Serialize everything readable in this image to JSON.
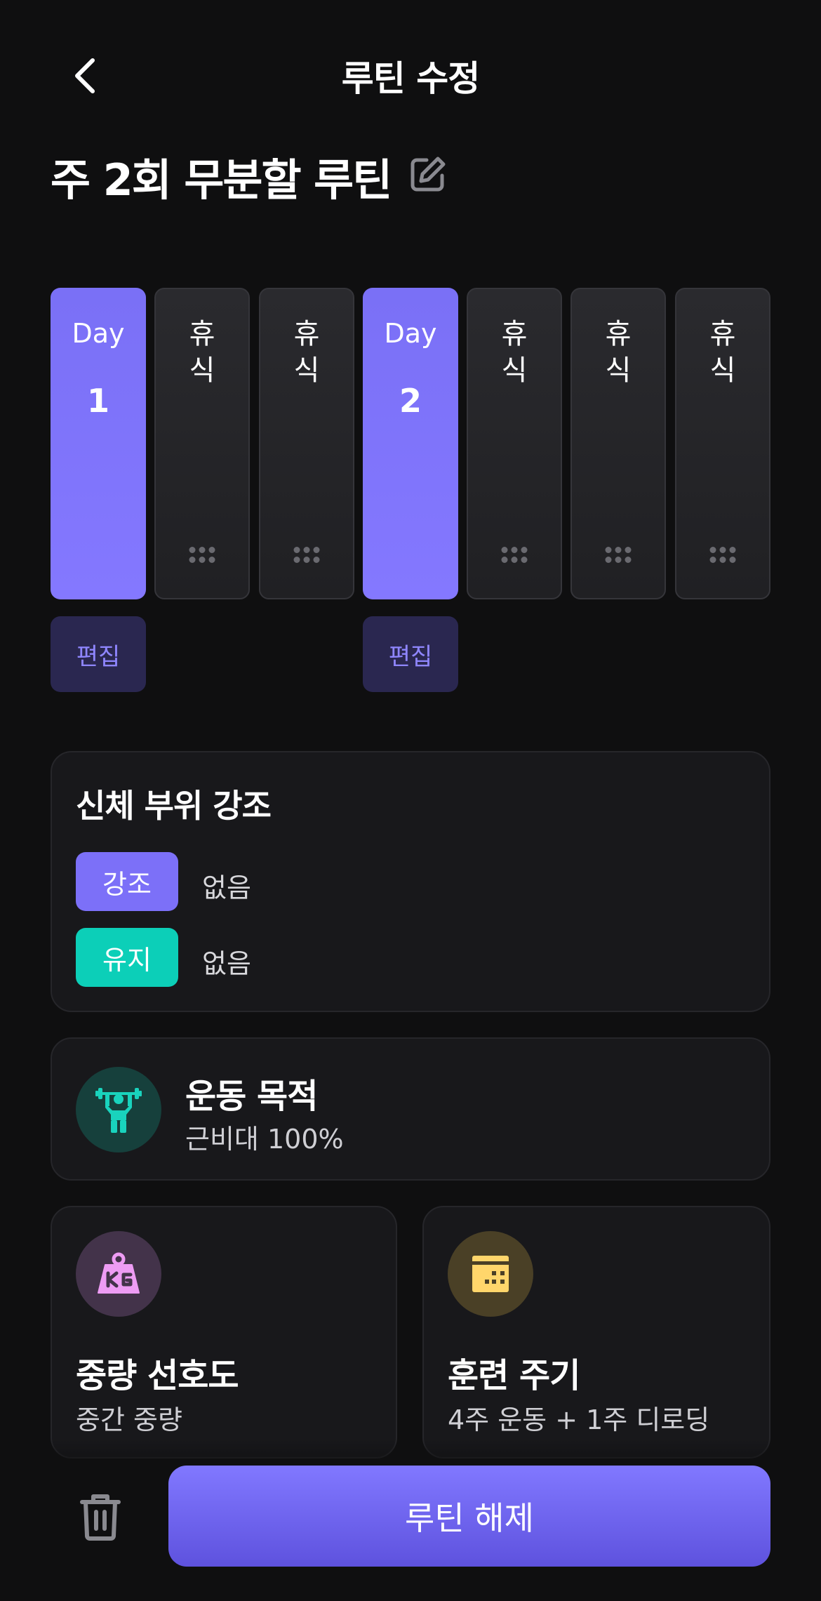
{
  "header": {
    "title": "루틴 수정",
    "back_icon": "chevron-left-icon"
  },
  "routine": {
    "title": "주 2회 무분할 루틴",
    "edit_icon": "pencil-square-icon"
  },
  "days": [
    {
      "type": "work",
      "label": "Day",
      "number": "1",
      "edit_label": "편집"
    },
    {
      "type": "rest",
      "char1": "휴",
      "char2": "식"
    },
    {
      "type": "rest",
      "char1": "휴",
      "char2": "식"
    },
    {
      "type": "work",
      "label": "Day",
      "number": "2",
      "edit_label": "편집"
    },
    {
      "type": "rest",
      "char1": "휴",
      "char2": "식"
    },
    {
      "type": "rest",
      "char1": "휴",
      "char2": "식"
    },
    {
      "type": "rest",
      "char1": "휴",
      "char2": "식"
    }
  ],
  "emphasis": {
    "title": "신체 부위 강조",
    "emphasis_label": "강조",
    "emphasis_value": "없음",
    "maintain_label": "유지",
    "maintain_value": "없음"
  },
  "goal": {
    "title": "운동 목적",
    "value": "근비대 100%",
    "icon": "weightlifter-icon"
  },
  "weight_pref": {
    "title": "중량 선호도",
    "value": "중간 중량",
    "icon": "kettlebell-kg-icon"
  },
  "cycle": {
    "title": "훈련 주기",
    "value": "4주 운동 + 1주 디로딩",
    "icon": "calendar-icon"
  },
  "footer": {
    "delete_icon": "trash-icon",
    "release_label": "루틴 해제"
  },
  "colors": {
    "accent": "#7c70f8",
    "teal": "#0ccfb8",
    "background": "#0f0f10",
    "card": "#18181b"
  }
}
